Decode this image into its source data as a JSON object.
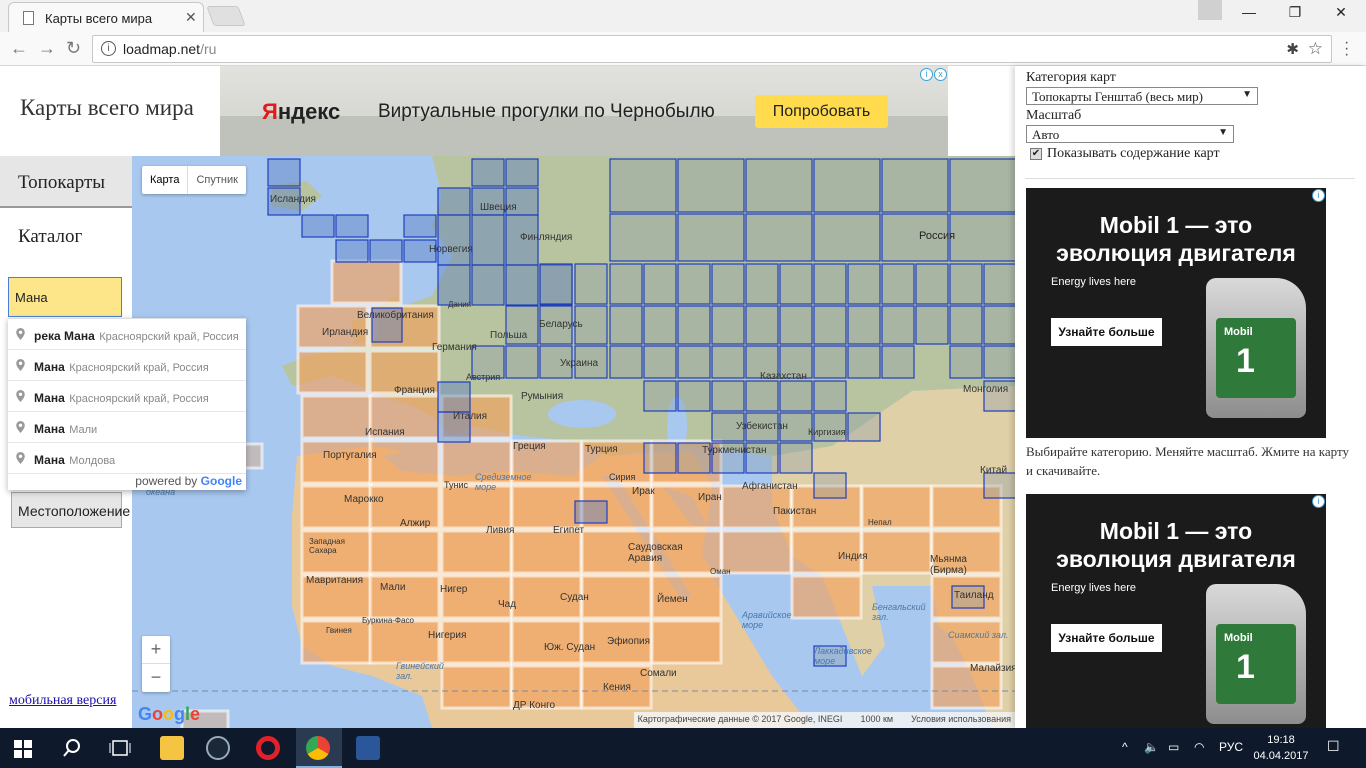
{
  "browser": {
    "tab_title": "Карты всего мира",
    "url_host": "loadmap.net",
    "url_path": "/ru"
  },
  "page": {
    "site_title": "Карты всего мира",
    "menu": {
      "topo": "Топокарты",
      "catalog": "Каталог"
    },
    "search_value": "Мана",
    "location_button": "Местоположение",
    "mobile_link": "мобильная версия"
  },
  "ad_top": {
    "brand_prefix": "Я",
    "brand_rest": "ндекс",
    "text": "Виртуальные прогулки по Чернобылю",
    "button": "Попробовать"
  },
  "autocomplete": {
    "items": [
      {
        "main": "река Мана",
        "secondary": "Красноярский край, Россия"
      },
      {
        "main": "Мана",
        "secondary": "Красноярский край, Россия"
      },
      {
        "main": "Мана",
        "secondary": "Красноярский край, Россия"
      },
      {
        "main": "Мана",
        "secondary": "Мали"
      },
      {
        "main": "Мана",
        "secondary": "Молдова"
      }
    ],
    "powered_by": "powered by",
    "powered_brand": "Google"
  },
  "map": {
    "type_map": "Карта",
    "type_satellite": "Спутник",
    "zoom_in": "+",
    "zoom_out": "−",
    "google_logo": "Google",
    "attribution": "Картографические данные © 2017 Google, INEGI",
    "scale": "1000 км",
    "terms": "Условия использования",
    "labels": {
      "iceland": "Исландия",
      "sweden": "Швеция",
      "finland": "Финляндия",
      "norway": "Норвегия",
      "russia": "Россия",
      "uk": "Великобритания",
      "ireland": "Ирландия",
      "denmark": "Дания",
      "poland": "Польша",
      "belarus": "Беларусь",
      "germany": "Германия",
      "ukraine": "Украина",
      "austria": "Австрия",
      "france": "Франция",
      "romania": "Румыния",
      "kazakhstan": "Казахстан",
      "mongolia": "Монголия",
      "italy": "Италия",
      "spain": "Испания",
      "portugal": "Португалия",
      "greece": "Греция",
      "turkey": "Турция",
      "uzbekistan": "Узбекистан",
      "kyrgyzstan": "Киргизия",
      "turkmenistan": "Туркменистан",
      "china": "Китай",
      "tunisia": "Тунис",
      "syria": "Сирия",
      "mediterranean": "Средиземное море",
      "iraq": "Ирак",
      "iran": "Иран",
      "afghanistan": "Афганистан",
      "morocco": "Марокко",
      "algeria": "Алжир",
      "libya": "Ливия",
      "egypt": "Египет",
      "pakistan": "Пакистан",
      "nepal": "Непал",
      "ocean": "океана",
      "western_sahara": "Западная Сахара",
      "saudi": "Саудовская Аравия",
      "india": "Индия",
      "myanmar": "Мьянма (Бирма)",
      "mauritania": "Мавритания",
      "mali": "Мали",
      "niger": "Нигер",
      "chad": "Чад",
      "sudan": "Судан",
      "oman": "Оман",
      "yemen": "Йемен",
      "arabian_sea": "Аравийское море",
      "bengal": "Бенгальский зал.",
      "thailand": "Таиланд",
      "burkina": "Буркина-Фасо",
      "guinea": "Гвинея",
      "nigeria": "Нигерия",
      "ethiopia": "Эфиопия",
      "south_sudan": "Юж. Судан",
      "laccadive": "Лаккадивское море",
      "siam": "Сиамский зал.",
      "guinea_gulf": "Гвинейский зал.",
      "somalia": "Сомали",
      "malaysia": "Малайзия",
      "kenya": "Кения",
      "drc": "ДР Конго"
    }
  },
  "right_panel": {
    "category_label": "Категория карт",
    "category_value": "Топокарты Генштаб (весь мир)",
    "scale_label": "Масштаб",
    "scale_value": "Авто",
    "show_contents_label": "Показывать содержание карт",
    "ad_headline_1": "Mobil 1 — это",
    "ad_headline_2": "эволюция двигателя",
    "ad_energy": "Energy lives here",
    "ad_button": "Узнайте больше",
    "ad_brand": "Mobil",
    "ad_number": "1",
    "description": "Выбирайте категорию. Меняйте масштаб. Жмите на карту и скачивайте."
  },
  "taskbar": {
    "lang": "РУС",
    "time": "19:18",
    "date": "04.04.2017"
  },
  "colors": {
    "grid_blue": "#1f3fbf",
    "grid_orange": "#f2a25c",
    "search_bg": "#fde68a",
    "yandex_button": "#ffdb4d"
  }
}
